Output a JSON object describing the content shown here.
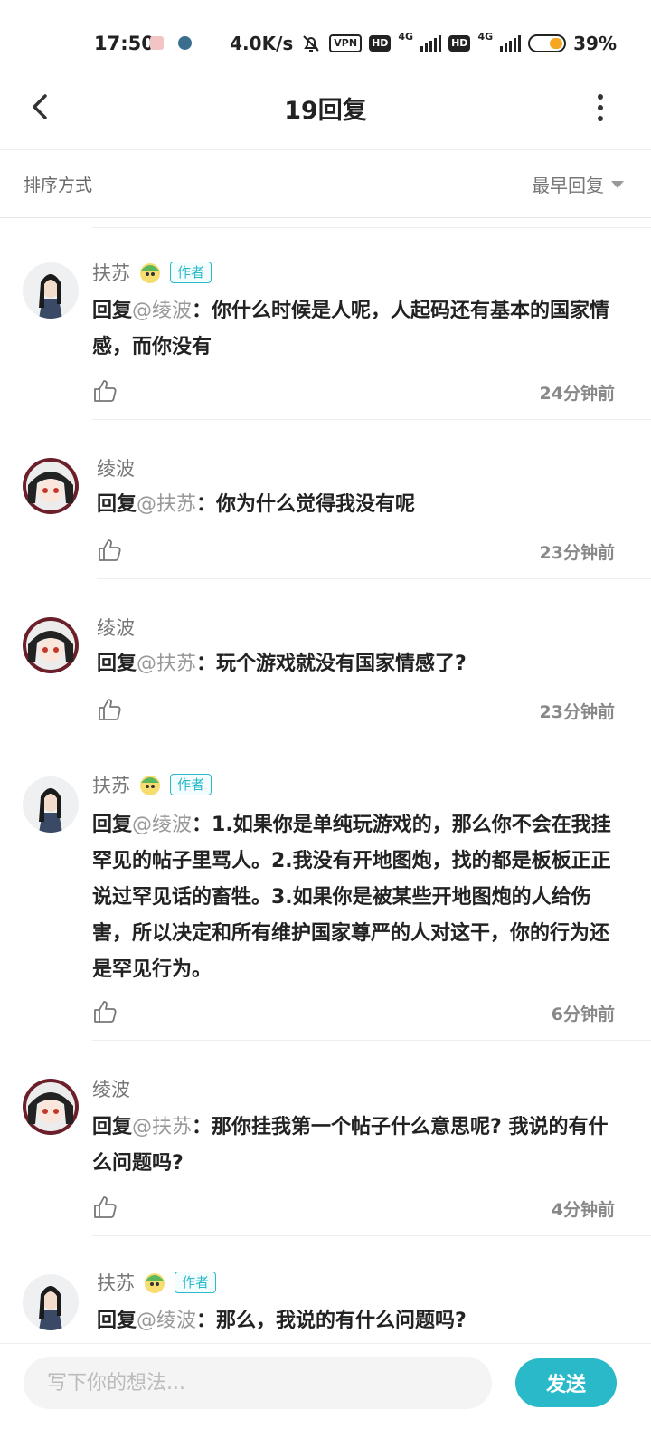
{
  "status_bar": {
    "time": "17:50",
    "net_speed": "4.0K/s",
    "vpn": "VPN",
    "hd1": "HD",
    "net1": "4G",
    "hd2": "HD",
    "net2": "4G",
    "battery_percent": "39%",
    "battery_level": 0.39
  },
  "header": {
    "title": "19回复"
  },
  "sort": {
    "label": "排序方式",
    "value": "最早回复"
  },
  "comments": [
    {
      "name": "扶苏",
      "is_author": true,
      "author_tag": "作者",
      "reply_prefix": "回复",
      "mention": "@绫波",
      "text": "：你什么时候是人呢，人起码还有基本的国家情感，而你没有",
      "time": "24分钟前",
      "avatar": "avatar-fusu"
    },
    {
      "name": "绫波",
      "is_author": false,
      "reply_prefix": "回复",
      "mention": "@扶苏",
      "text": "：你为什么觉得我没有呢",
      "time": "23分钟前",
      "avatar": "avatar-lingbo"
    },
    {
      "name": "绫波",
      "is_author": false,
      "reply_prefix": "回复",
      "mention": "@扶苏",
      "text": "：玩个游戏就没有国家情感了?",
      "time": "23分钟前",
      "avatar": "avatar-lingbo"
    },
    {
      "name": "扶苏",
      "is_author": true,
      "author_tag": "作者",
      "reply_prefix": "回复",
      "mention": "@绫波",
      "text": "：1.如果你是单纯玩游戏的，那么你不会在我挂罕见的帖子里骂人。2.我没有开地图炮，找的都是板板正正说过罕见话的畜牲。3.如果你是被某些开地图炮的人给伤害，所以决定和所有维护国家尊严的人对这干，你的行为还是罕见行为。",
      "time": "6分钟前",
      "avatar": "avatar-fusu"
    },
    {
      "name": "绫波",
      "is_author": false,
      "reply_prefix": "回复",
      "mention": "@扶苏",
      "text": "：那你挂我第一个帖子什么意思呢? 我说的有什么问题吗?",
      "time": "4分钟前",
      "avatar": "avatar-lingbo"
    },
    {
      "name": "扶苏",
      "is_author": true,
      "author_tag": "作者",
      "reply_prefix": "回复",
      "mention": "@绫波",
      "text": "：那么，我说的有什么问题吗?",
      "time": "",
      "avatar": "avatar-fusu"
    }
  ],
  "composer": {
    "placeholder": "写下你的想法...",
    "send_label": "发送"
  },
  "colors": {
    "accent": "#29b9c9",
    "battery": "#f5a623"
  }
}
